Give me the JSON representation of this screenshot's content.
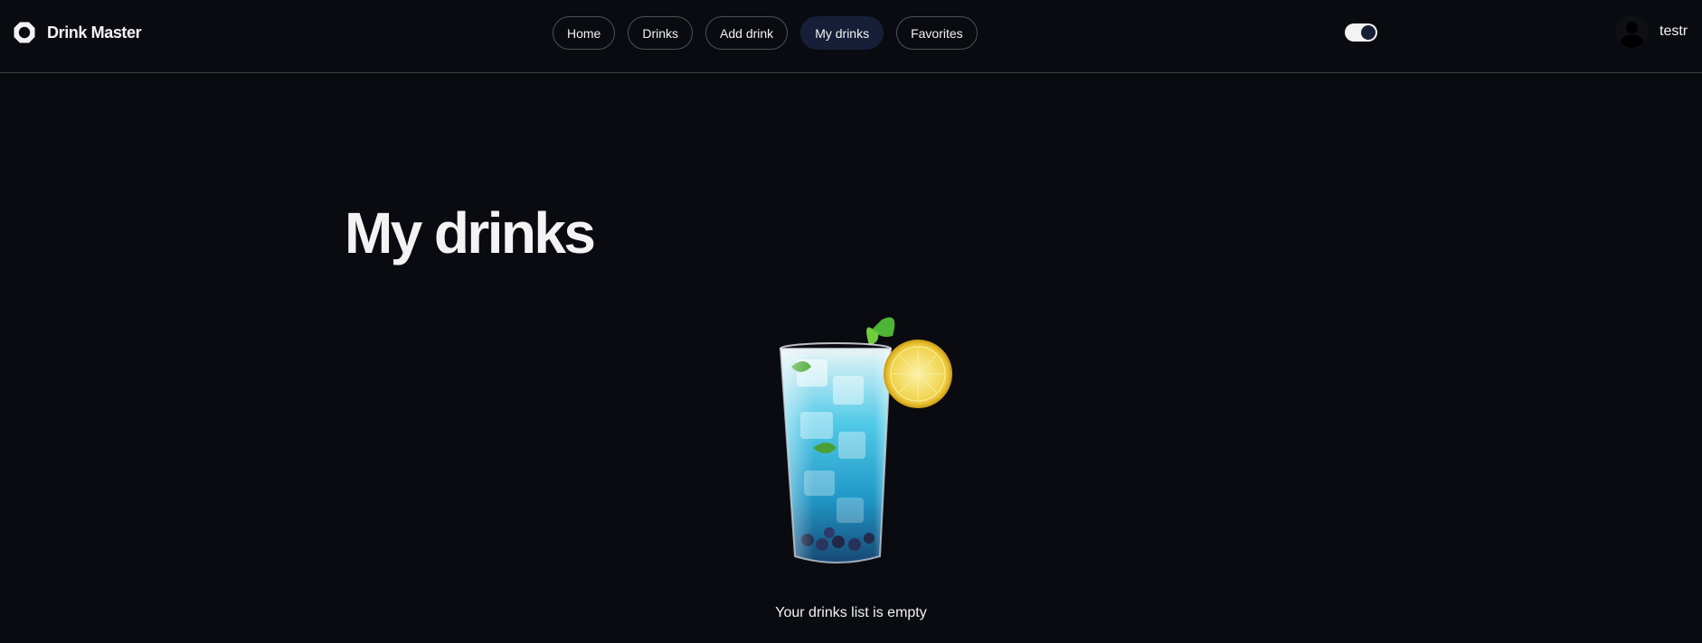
{
  "app": {
    "name": "Drink Master",
    "logo_icon": "hexagon-ring-logo"
  },
  "nav": {
    "items": [
      {
        "label": "Home",
        "active": false
      },
      {
        "label": "Drinks",
        "active": false
      },
      {
        "label": "Add drink",
        "active": false
      },
      {
        "label": "My drinks",
        "active": true
      },
      {
        "label": "Favorites",
        "active": false
      }
    ]
  },
  "theme_toggle": {
    "state": "on",
    "icon": "toggle-switch"
  },
  "user": {
    "name": "testr",
    "avatar_icon": "user-silhouette-icon"
  },
  "page": {
    "title": "My drinks",
    "empty_message": "Your drinks list is empty",
    "illustration": "blue-cocktail-glass-with-lemon-and-mint"
  },
  "colors": {
    "background": "#0a0b10",
    "text": "#f3f3f3",
    "active_nav": "#161f37",
    "border": "rgba(243,243,243,0.30)"
  }
}
